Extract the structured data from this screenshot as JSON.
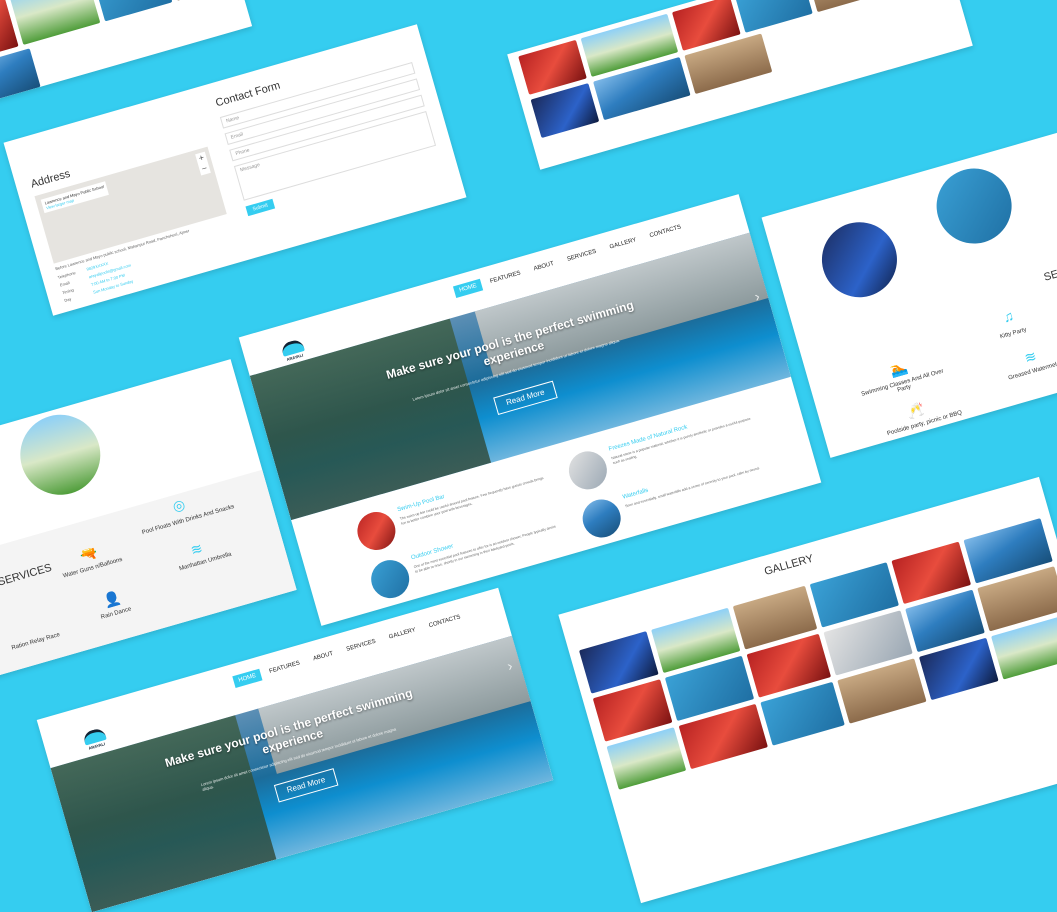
{
  "nav": [
    "HOME",
    "FEATURES",
    "ABOUT",
    "SERVICES",
    "GALLERY",
    "CONTACTS"
  ],
  "logo": "ARAYALI",
  "hero": {
    "title": "Make sure your pool is the perfect swimming experience",
    "subtitle": "Lorem ipsum dolor sit amet consectetur adipiscing elit sed do eiusmod tempor incididunt ut labore et dolore magna aliqua.",
    "button": "Read More"
  },
  "features": [
    {
      "title": "Swim-Up Pool Bar",
      "text": "The swim-up bar could be useful around pool feature. Few frequently have guests crowds brings fun to better combine your pool with beverages."
    },
    {
      "title": "Outdoor Shower",
      "text": "One of the most essential pool features to offer for is an outdoor shower. People typically desire to be able to rinse, shortly in our swimming in their backyard pools."
    },
    {
      "title": "Freezes Made of Natural Rock",
      "text": "Natural stone is a popular material, whether it is purely aesthetic or provides a useful purpose such as seating."
    },
    {
      "title": "Waterfalls",
      "text": "Seen and essentially, small waterfalls add a sense of serenity to your pool, calm by sound."
    }
  ],
  "contact": {
    "address_heading": "Address",
    "form_heading": "Contact Form",
    "fields": [
      "Name",
      "Email",
      "Phone",
      "Message"
    ],
    "submit": "Submit",
    "map_label": "Lawrence and Mayo Public School",
    "map_link": "View larger map",
    "address_line": "Before Lawrence and Mayo public school, Makanpur Road, Panchsheel, Ajmer",
    "rows": [
      {
        "k": "Telephone",
        "v": "9829XXXXX"
      },
      {
        "k": "Email",
        "v": "arayalipools@gmail.com"
      },
      {
        "k": "Timing",
        "v": "7:00 AM to 7:00 PM"
      },
      {
        "k": "Day",
        "v": "Sun Monday to Sunday"
      }
    ]
  },
  "services_left": {
    "heading": "SERVICES",
    "items": [
      "Water Guns n/Balloons",
      "Pool Floats With Drinks And Snacks",
      "Rain Dance",
      "Manhattan Umbrella",
      "Ration Relay Race"
    ]
  },
  "services_right": {
    "heading": "SERVI",
    "items": [
      "Swimming Classes And All Over Party",
      "Kitty Party",
      "Poolside party, picnic or BBQ",
      "Greased Watermelon Relay"
    ]
  },
  "gallery": {
    "heading": "GALLERY"
  },
  "colors": {
    "accent": "#35cdf0",
    "background": "#35cdf0"
  }
}
